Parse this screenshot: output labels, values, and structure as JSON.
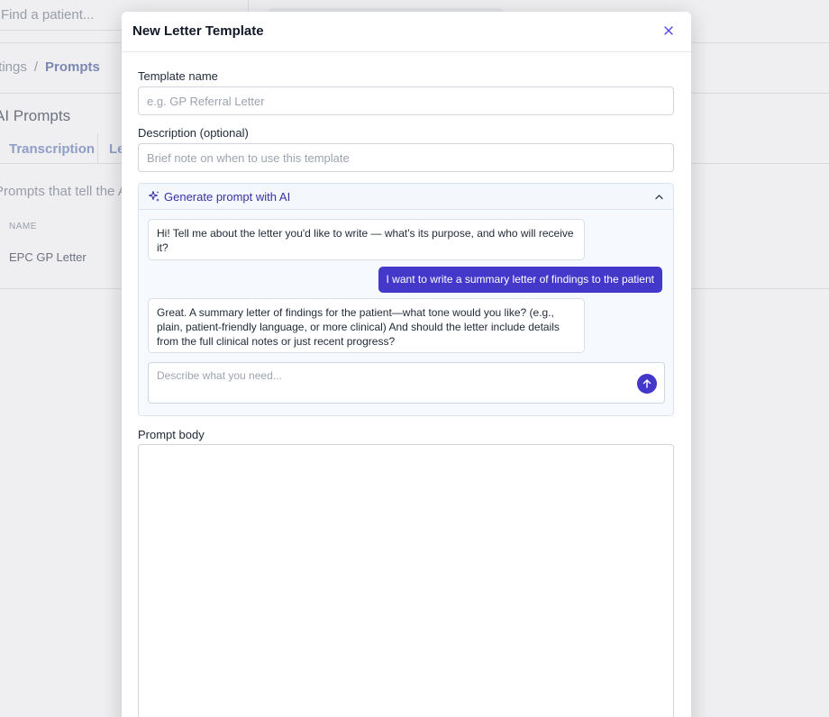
{
  "background": {
    "search_placeholder": "Find a patient...",
    "breadcrumb": {
      "parent": "ttings",
      "separator": "/",
      "current": "Prompts"
    },
    "heading": "AI Prompts",
    "tabs": [
      "Transcription",
      "Le"
    ],
    "description": "Prompts that tell the AI",
    "table": {
      "column_header": "NAME",
      "rows": [
        "EPC GP Letter"
      ]
    }
  },
  "modal": {
    "title": "New Letter Template",
    "close_icon": "close-icon",
    "template_name": {
      "label": "Template name",
      "placeholder": "e.g. GP Referral Letter",
      "value": ""
    },
    "description": {
      "label": "Description (optional)",
      "placeholder": "Brief note on when to use this template",
      "value": ""
    },
    "ai_panel": {
      "title": "Generate prompt with AI",
      "icon": "sparkle-icon",
      "toggle_icon": "chevron-up-icon",
      "messages": [
        {
          "role": "assistant",
          "text": "Hi! Tell me about the letter you'd like to write — what's its purpose, and who will receive it?"
        },
        {
          "role": "user",
          "text": "I want to write a summary letter of findings to the patient"
        },
        {
          "role": "assistant",
          "text": "Great. A summary letter of findings for the patient—what tone would you like? (e.g., plain, patient-friendly language, or more clinical) And should the letter include details from the full clinical notes or just recent progress?"
        }
      ],
      "input_placeholder": "Describe what you need...",
      "send_icon": "arrow-up-icon"
    },
    "prompt_body": {
      "label": "Prompt body",
      "value": ""
    }
  },
  "colors": {
    "accent": "#4338ca",
    "accent_text": "#3730a3",
    "panel_bg": "#f6f9fd",
    "border": "#d1d5db"
  }
}
